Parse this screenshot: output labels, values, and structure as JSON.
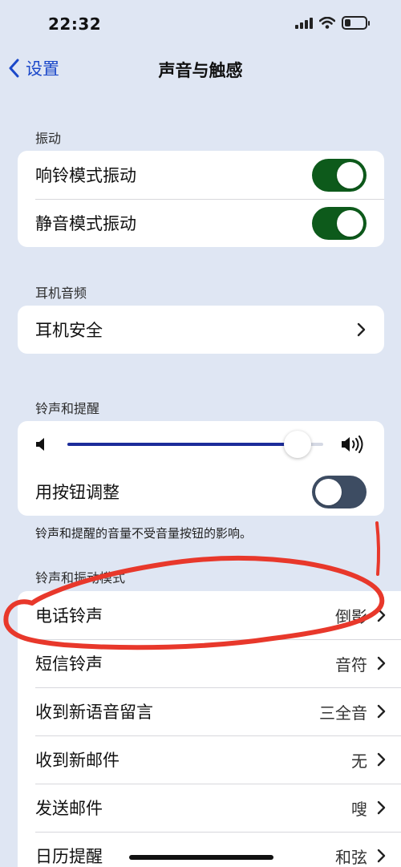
{
  "status_bar": {
    "time": "22:32",
    "battery_level": 0.3
  },
  "nav": {
    "back_label": "设置",
    "title": "声音与触感"
  },
  "sections": {
    "vibration": {
      "header": "振动",
      "rows": [
        {
          "label": "响铃模式振动",
          "toggle": "on"
        },
        {
          "label": "静音模式振动",
          "toggle": "on"
        }
      ]
    },
    "headphone": {
      "header": "耳机音频",
      "rows": [
        {
          "label": "耳机安全"
        }
      ]
    },
    "ringer": {
      "header": "铃声和提醒",
      "volume_level": 0.9,
      "change_with_buttons": {
        "label": "用按钮调整",
        "toggle": "off"
      },
      "footer": "铃声和提醒的音量不受音量按钮的影响。"
    },
    "patterns": {
      "header": "铃声和振动模式",
      "rows": [
        {
          "label": "电话铃声",
          "value": "倒影"
        },
        {
          "label": "短信铃声",
          "value": "音符"
        },
        {
          "label": "收到新语音留言",
          "value": "三全音"
        },
        {
          "label": "收到新邮件",
          "value": "无"
        },
        {
          "label": "发送邮件",
          "value": "嗖"
        },
        {
          "label": "日历提醒",
          "value": "和弦"
        }
      ]
    }
  },
  "colors": {
    "background": "#dfe6f3",
    "accent": "#1b48c9",
    "toggle_on": "#0d5a1b",
    "toggle_off": "#3d4c62",
    "annotation": "#e8382b"
  },
  "icons": [
    "signal-icon",
    "wifi-icon",
    "battery-icon",
    "chevron-left-icon",
    "chevron-right-icon",
    "speaker-low-icon",
    "speaker-high-icon"
  ]
}
